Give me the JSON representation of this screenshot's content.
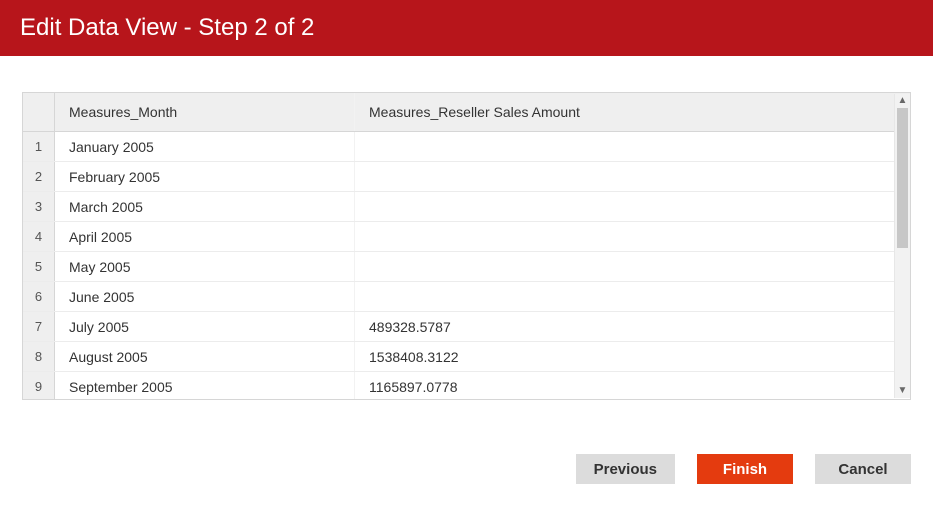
{
  "title": "Edit Data View - Step 2 of 2",
  "columns": {
    "month": "Measures_Month",
    "amount": "Measures_Reseller Sales Amount"
  },
  "rows": [
    {
      "n": "1",
      "month": "January 2005",
      "amount": ""
    },
    {
      "n": "2",
      "month": "February 2005",
      "amount": ""
    },
    {
      "n": "3",
      "month": "March 2005",
      "amount": ""
    },
    {
      "n": "4",
      "month": "April 2005",
      "amount": ""
    },
    {
      "n": "5",
      "month": "May 2005",
      "amount": ""
    },
    {
      "n": "6",
      "month": "June 2005",
      "amount": ""
    },
    {
      "n": "7",
      "month": "July 2005",
      "amount": "489328.5787"
    },
    {
      "n": "8",
      "month": "August 2005",
      "amount": "1538408.3122"
    },
    {
      "n": "9",
      "month": "September 2005",
      "amount": "1165897.0778"
    }
  ],
  "buttons": {
    "previous": "Previous",
    "finish": "Finish",
    "cancel": "Cancel"
  }
}
